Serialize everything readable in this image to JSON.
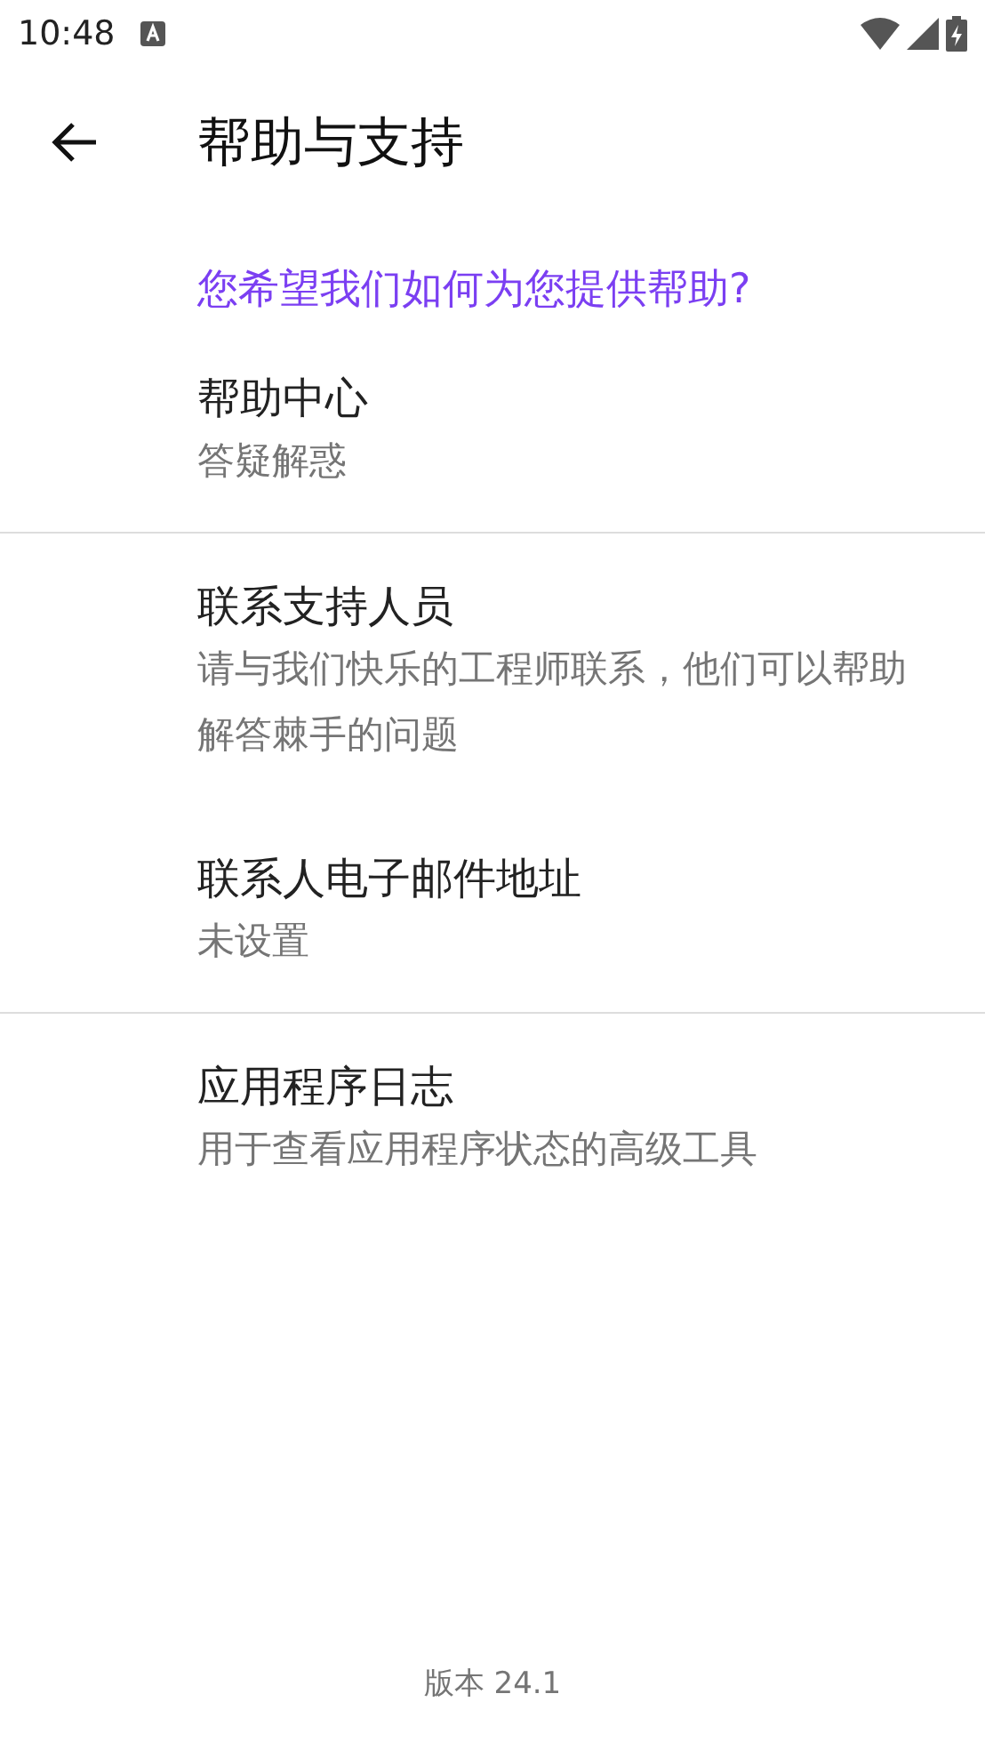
{
  "status_bar": {
    "time": "10:48"
  },
  "app_bar": {
    "title": "帮助与支持"
  },
  "section_header": "您希望我们如何为您提供帮助?",
  "items": [
    {
      "title": "帮助中心",
      "subtitle": "答疑解惑",
      "divider_after": true
    },
    {
      "title": "联系支持人员",
      "subtitle": "请与我们快乐的工程师联系，他们可以帮助解答棘手的问题",
      "divider_after": false
    },
    {
      "title": "联系人电子邮件地址",
      "subtitle": "未设置",
      "divider_after": true
    },
    {
      "title": "应用程序日志",
      "subtitle": "用于查看应用程序状态的高级工具",
      "divider_after": false
    }
  ],
  "footer": "版本 24.1"
}
